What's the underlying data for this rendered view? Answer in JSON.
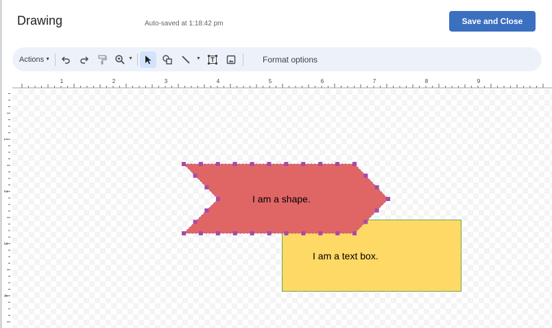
{
  "header": {
    "title": "Drawing",
    "autosave": "Auto-saved at 1:18:42 pm",
    "save_close_label": "Save and Close"
  },
  "toolbar": {
    "actions_label": "Actions",
    "format_options_label": "Format options",
    "icons": [
      "undo-icon",
      "redo-icon",
      "paint-format-icon",
      "zoom-icon",
      "select-icon",
      "shape-icon",
      "line-icon",
      "text-box-icon",
      "image-icon"
    ]
  },
  "ruler": {
    "horizontal_labels": [
      "1",
      "2",
      "3",
      "4",
      "5",
      "6",
      "7",
      "8",
      "9"
    ],
    "vertical_labels": [
      "1",
      "2",
      "3",
      "4"
    ]
  },
  "canvas": {
    "shape": {
      "label": "I am a shape.",
      "fill": "#e06666",
      "handle_color": "#a64ca6"
    },
    "text_box": {
      "label": "I am a text box.",
      "fill": "#ffd966",
      "border": "#6aa84f"
    }
  },
  "colors": {
    "accent": "#3b6fc0",
    "toolbar_bg": "#edf2fa",
    "selected_tool_bg": "#d3e3fd"
  }
}
